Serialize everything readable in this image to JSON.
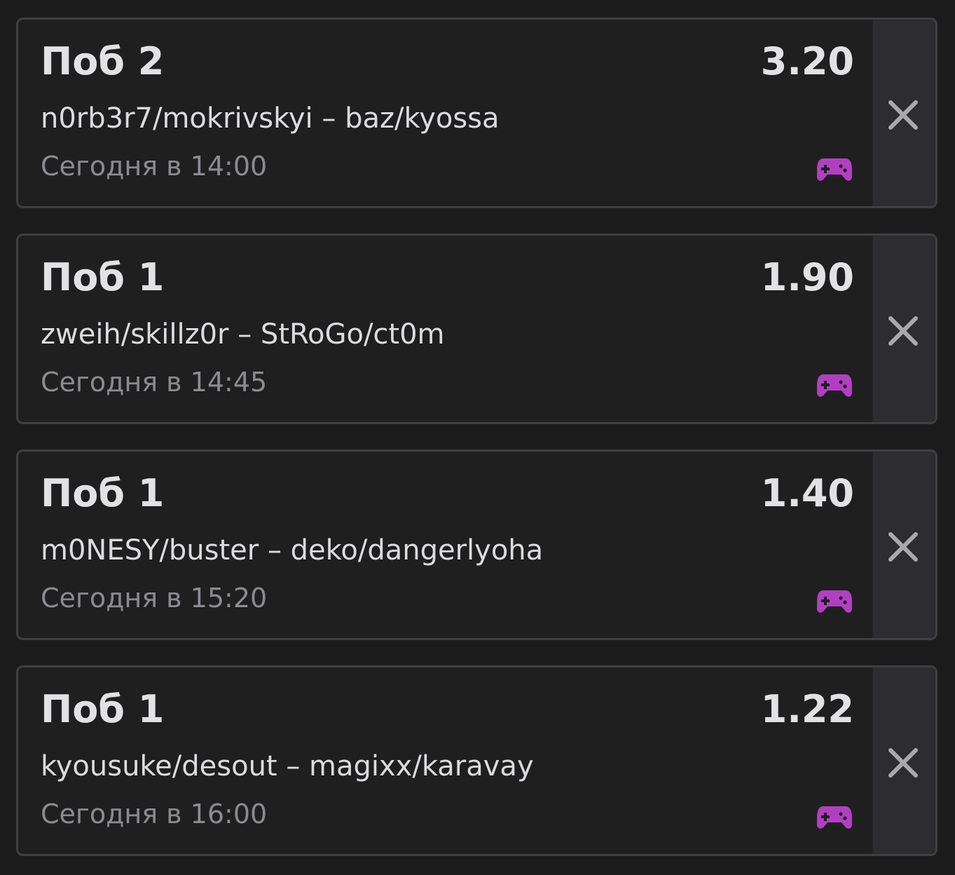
{
  "bets": [
    {
      "market": "Поб 2",
      "odds": "3.20",
      "teams": "n0rb3r7/mokrivskyi – baz/kyossa",
      "datetime": "Сегодня в 14:00",
      "icon": "gamepad-icon"
    },
    {
      "market": "Поб 1",
      "odds": "1.90",
      "teams": "zweih/skillz0r – StRoGo/ct0m",
      "datetime": "Сегодня в 14:45",
      "icon": "gamepad-icon"
    },
    {
      "market": "Поб 1",
      "odds": "1.40",
      "teams": "m0NESY/buster – deko/dangerlyoha",
      "datetime": "Сегодня в 15:20",
      "icon": "gamepad-icon"
    },
    {
      "market": "Поб 1",
      "odds": "1.22",
      "teams": "kyousuke/desout – magixx/karavay",
      "datetime": "Сегодня в 16:00",
      "icon": "gamepad-icon"
    }
  ],
  "colors": {
    "gamepad": "#b23fc2",
    "close": "#a8a8ad"
  }
}
